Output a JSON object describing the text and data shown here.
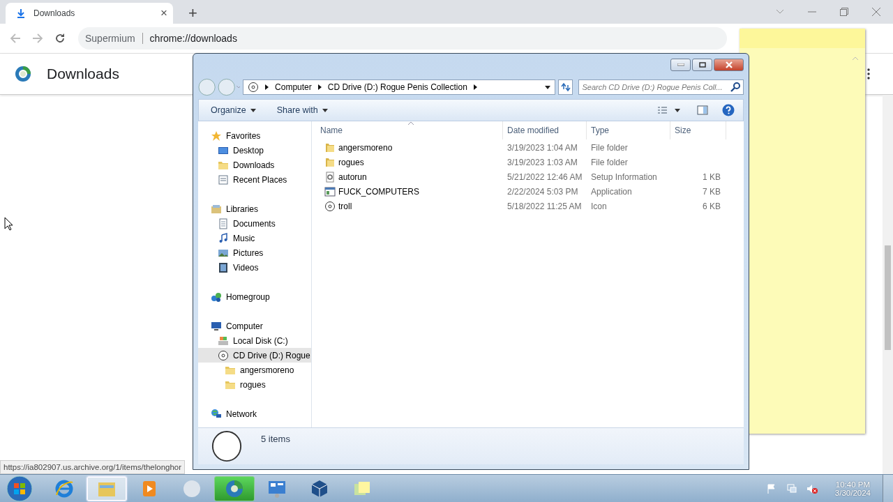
{
  "browser": {
    "tab_title": "Downloads",
    "tab_close": "×",
    "new_tab": "+",
    "address_site": "Supermium",
    "address_url": "chrome://downloads",
    "page_title": "Downloads",
    "status_url": "https://ia802907.us.archive.org/1/items/thelonghor"
  },
  "explorer": {
    "breadcrumb": [
      "Computer",
      "CD Drive (D:) Rogue Penis Collection"
    ],
    "search_placeholder": "Search CD Drive (D:) Rogue Penis Coll...",
    "toolbar": [
      "Organize",
      "Share with"
    ],
    "nav": [
      {
        "label": "Favorites",
        "kind": "star",
        "selected": false,
        "children": [
          {
            "label": "Desktop",
            "kind": "desktop",
            "selected": false
          },
          {
            "label": "Downloads",
            "kind": "folder",
            "selected": false
          },
          {
            "label": "Recent Places",
            "kind": "recent",
            "selected": false
          }
        ]
      },
      {
        "label": "Libraries",
        "kind": "library",
        "selected": false,
        "children": [
          {
            "label": "Documents",
            "kind": "doc",
            "selected": false
          },
          {
            "label": "Music",
            "kind": "music",
            "selected": false
          },
          {
            "label": "Pictures",
            "kind": "pictures",
            "selected": false
          },
          {
            "label": "Videos",
            "kind": "video",
            "selected": false
          }
        ]
      },
      {
        "label": "Homegroup",
        "kind": "homegroup",
        "selected": false
      },
      {
        "label": "Computer",
        "kind": "computer",
        "selected": false,
        "children": [
          {
            "label": "Local Disk (C:)",
            "kind": "disk",
            "selected": false
          },
          {
            "label": "CD Drive (D:) Rogue",
            "kind": "cd",
            "selected": true,
            "children": [
              {
                "label": "angersmoreno",
                "kind": "folder",
                "selected": false
              },
              {
                "label": "rogues",
                "kind": "folder",
                "selected": false
              }
            ]
          }
        ]
      },
      {
        "label": "Network",
        "kind": "network",
        "selected": false
      }
    ],
    "columns": [
      "Name",
      "Date modified",
      "Type",
      "Size"
    ],
    "files": [
      {
        "name": "angersmoreno",
        "date": "3/19/2023 1:04 AM",
        "type": "File folder",
        "kind": "folder"
      },
      {
        "name": "rogues",
        "date": "3/19/2023 1:03 AM",
        "type": "File folder",
        "kind": "folder"
      },
      {
        "name": "autorun",
        "date": "5/21/2022 12:46 AM",
        "type": "Setup Information",
        "size": "1 KB",
        "kind": "setup"
      },
      {
        "name": "FUCK_COMPUTERS",
        "date": "2/22/2024 5:03 PM",
        "type": "Application",
        "size": "7 KB",
        "kind": "app"
      },
      {
        "name": "troll",
        "date": "5/18/2022 11:25 AM",
        "type": "Icon",
        "size": "6 KB",
        "kind": "cd"
      }
    ],
    "status": "5 items"
  },
  "taskbar": {
    "apps": [
      {
        "kind": "ie",
        "selected": false,
        "flashing": false
      },
      {
        "kind": "explorer",
        "selected": true,
        "flashing": false
      },
      {
        "kind": "media",
        "selected": false,
        "flashing": false
      },
      {
        "kind": "orb",
        "selected": false,
        "flashing": false
      },
      {
        "kind": "browser",
        "selected": false,
        "flashing": true
      },
      {
        "kind": "control",
        "selected": false,
        "flashing": false
      },
      {
        "kind": "box",
        "selected": false,
        "flashing": false
      },
      {
        "kind": "notes",
        "selected": false,
        "flashing": false
      }
    ],
    "time": "10:40 PM",
    "date": "3/30/2024"
  }
}
